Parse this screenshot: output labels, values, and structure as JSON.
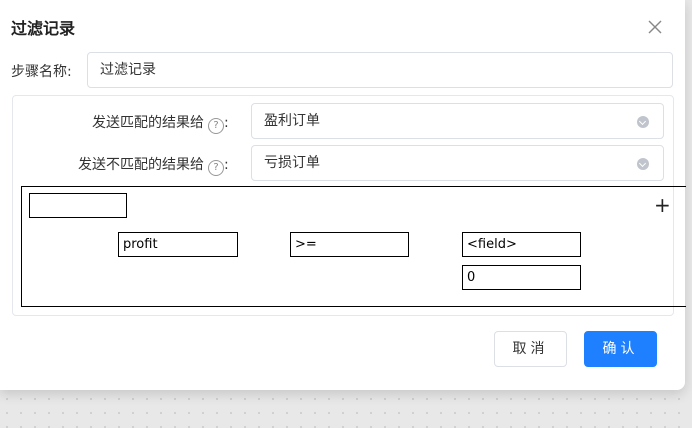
{
  "dialog": {
    "title": "过滤记录",
    "close_icon": "close-icon"
  },
  "step": {
    "label": "步骤名称:",
    "value": "过滤记录"
  },
  "send_match": {
    "label": "发送匹配的结果给",
    "help_icon": "question-circle-icon",
    "colon": ":",
    "value": "盈利订单"
  },
  "send_nomatch": {
    "label": "发送不匹配的结果给",
    "help_icon": "question-circle-icon",
    "colon": ":",
    "value": "亏损订单"
  },
  "condition": {
    "top_value": "",
    "field": "profit",
    "operator": ">=",
    "compare_field": "<field>",
    "compare_value": "0",
    "add_icon": "plus-icon",
    "add_label": "+"
  },
  "buttons": {
    "cancel": "取消",
    "ok": "确认"
  },
  "colors": {
    "primary": "#1e80ff",
    "border": "#dcdfe6"
  }
}
